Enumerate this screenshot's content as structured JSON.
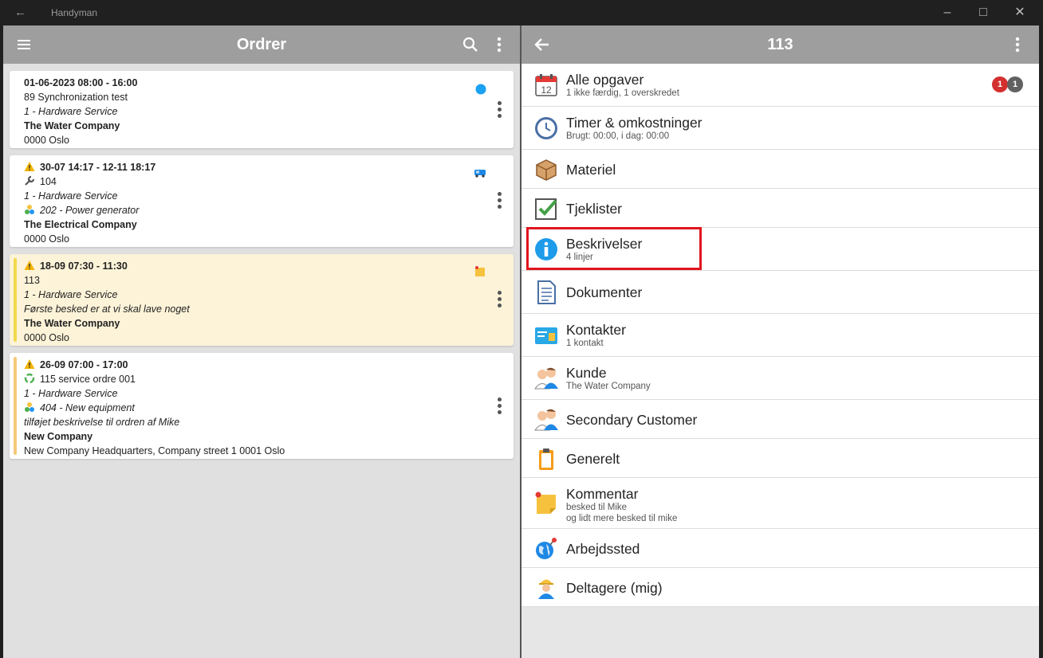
{
  "window": {
    "title": "Handyman"
  },
  "left": {
    "title": "Ordrer",
    "orders": [
      {
        "date": "01-06-2023 08:00 - 16:00",
        "lines": [
          "89 Synchronization test",
          "1 - Hardware Service",
          "The Water Company",
          "0000 Oslo"
        ]
      },
      {
        "date": "30-07 14:17 - 12-11 18:17",
        "lines": [
          "104",
          "1 - Hardware Service",
          "202 - Power generator",
          "The Electrical Company",
          "0000 Oslo"
        ]
      },
      {
        "date": "18-09 07:30 - 11:30",
        "lines": [
          "113",
          "1 - Hardware Service",
          "Første besked er at vi skal lave noget",
          "The Water Company",
          "0000 Oslo"
        ]
      },
      {
        "date": "26-09 07:00 - 17:00",
        "lines": [
          "115 service ordre 001",
          "1 - Hardware Service",
          "404 - New equipment",
          "tilføjet beskrivelse til ordren af Mike",
          "New Company",
          "New Company Headquarters, Company street 1 0001 Oslo"
        ]
      }
    ]
  },
  "right": {
    "title": "113",
    "menu": [
      {
        "title": "Alle opgaver",
        "sub": "1 ikke færdig, 1 overskredet",
        "badge_red": "1",
        "badge_grey": "1"
      },
      {
        "title": "Timer & omkostninger",
        "sub": "Brugt: 00:00, i dag: 00:00"
      },
      {
        "title": "Materiel"
      },
      {
        "title": "Tjeklister"
      },
      {
        "title": "Beskrivelser",
        "sub": "4 linjer"
      },
      {
        "title": "Dokumenter"
      },
      {
        "title": "Kontakter",
        "sub": "1 kontakt"
      },
      {
        "title": "Kunde",
        "sub": "The Water Company"
      },
      {
        "title": "Secondary Customer"
      },
      {
        "title": "Generelt"
      },
      {
        "title": "Kommentar",
        "sub": "besked til Mike",
        "sub2": "og lidt mere besked til mike"
      },
      {
        "title": "Arbejdssted"
      },
      {
        "title": "Deltagere (mig)"
      }
    ]
  },
  "colors": {
    "appbar": "#9e9e9e",
    "highlight": "#e0141e",
    "badge_red": "#d32f2f",
    "badge_grey": "#616161",
    "stripe_yellow": "#f2d94e",
    "stripe_orange": "#f6c97a"
  },
  "calendar_icon_number": "12"
}
